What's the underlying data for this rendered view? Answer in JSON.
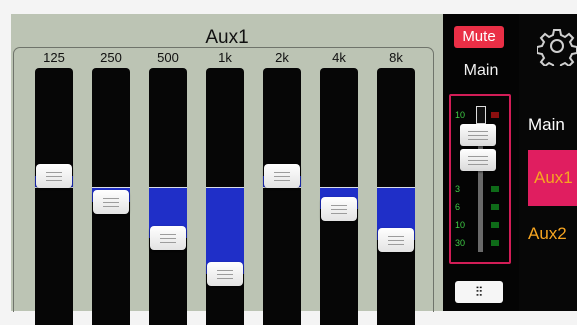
{
  "eq": {
    "title": "Aux1",
    "bands": [
      {
        "freq": "125",
        "level": 0.42
      },
      {
        "freq": "250",
        "level": 0.52
      },
      {
        "freq": "500",
        "level": 0.66
      },
      {
        "freq": "1k",
        "level": 0.8
      },
      {
        "freq": "2k",
        "level": 0.42
      },
      {
        "freq": "4k",
        "level": 0.55
      },
      {
        "freq": "8k",
        "level": 0.67
      }
    ],
    "colors": {
      "fill": "#1f2fc8",
      "track": "#060606",
      "panel": "#bcc4b4"
    }
  },
  "strip": {
    "mute_label": "Mute",
    "name": "Main",
    "scale": [
      "10",
      "0",
      "3",
      "6",
      "10",
      "30"
    ],
    "eq_toggle_icon": "sliders-icon",
    "eq_toggle_glyph": "⫶⫶"
  },
  "buses": {
    "items": [
      "Main",
      "Aux1",
      "Aux2"
    ],
    "selected": "Aux1",
    "settings_icon": "gear-icon"
  }
}
